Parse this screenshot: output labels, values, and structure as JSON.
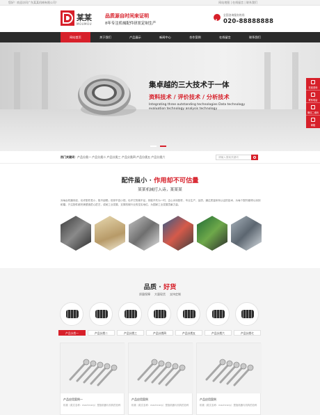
{
  "topbar": {
    "left": "您好！欢迎访问广东某某机械有限公司！",
    "right": "网站地图 | 在线留言 | 联系我们"
  },
  "header": {
    "brand": "某某",
    "brand_sub": "MOUMOU",
    "slogan_main": "品质源自时间来证明",
    "slogan_sub": "8年专注机械配件研发定制生产",
    "phone_label": "全国咨询服务热线",
    "phone": "020-88888888"
  },
  "nav": {
    "items": [
      "网站首页",
      "关于我们",
      "产品展示",
      "新闻中心",
      "合作案例",
      "在线留言",
      "联系我们"
    ],
    "active": 0
  },
  "banner": {
    "title": "集卓越的三大技术于一体",
    "techs": "资料技术 / 评价技术 / 分析技术",
    "desc": "Integrating three outstanding technologies Data technology evaluation technology analysis technology"
  },
  "side": {
    "items": [
      "在线咨询",
      "联系电话",
      "微信二维码",
      "邮箱",
      "返回顶部"
    ]
  },
  "search": {
    "hot_label": "热门关键词：",
    "hot_items": "产品分类一 产品分类二 产品分类三 产品分类四 产品分类五 产品分类六",
    "placeholder": "请输入搜索关键词"
  },
  "parts": {
    "title_main": "配件虽小 · ",
    "title_red": "作用却不可估量",
    "sub": "某某机械打入诗，某某某",
    "intro": "对每台机器而言，也许配件虽小，极不起眼；但却不容小视，也许它的微不足，却能不失为一时，否心对待配件，专业生产，品质，通过质量体系认证的技术，为每个配件都得以深刻耐磨，只注配件都完美塑造匠心匠艺，成就工业发展，支撑机械行业的坚实地位，为国家工业发展贡献力量。"
  },
  "quality": {
    "title_main": "品质 · ",
    "title_red": "好货",
    "features": [
      "质量保障",
      "大量现货",
      "支持定制"
    ],
    "tabs": [
      "产品分类一",
      "产品分类二",
      "产品分类三",
      "产品分类四",
      "产品分类五",
      "产品分类六",
      "产品分类七"
    ],
    "active_tab": 0,
    "products": [
      {
        "name": "产品应用案例一",
        "desc": "机械（英文名称：machinery）是指机器与机构的总称"
      },
      {
        "name": "产品应用案例",
        "desc": "机械（英文名称：machinery）是指机器与机构的总称"
      },
      {
        "name": "产品应用案例",
        "desc": "机械（英文名称：machinery）是指机器与机构的总称"
      }
    ]
  },
  "colors": {
    "accent": "#d7202a",
    "nav": "#2b2b2b"
  }
}
